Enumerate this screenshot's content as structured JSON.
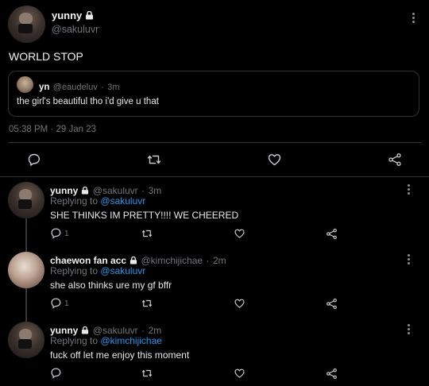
{
  "main_tweet": {
    "display_name": "yunny",
    "handle": "@sakuluvr",
    "text": "WORLD STOP",
    "timestamp": "05:38 PM",
    "date": "29 Jan 23",
    "separator": "·",
    "quote": {
      "display_name": "yn",
      "handle": "@eaudeluv",
      "time": "3m",
      "separator": "·",
      "text": "the girl's beautiful tho i'd give u that"
    }
  },
  "replies": [
    {
      "display_name": "yunny",
      "handle": "@sakuluvr",
      "time": "3m",
      "separator": "·",
      "replying_prefix": "Replying to",
      "replying_to": "@sakuluvr",
      "text": "SHE THINKS IM PRETTY!!!! WE CHEERED",
      "reply_count": "1"
    },
    {
      "display_name": "chaewon fan acc",
      "handle": "@kimchijichae",
      "time": "2m",
      "separator": "·",
      "replying_prefix": "Replying to",
      "replying_to": "@sakuluvr",
      "text": "she also thinks ure my gf bffr",
      "reply_count": "1"
    },
    {
      "display_name": "yunny",
      "handle": "@sakuluvr",
      "time": "2m",
      "separator": "·",
      "replying_prefix": "Replying to",
      "replying_to": "@kimchijichae",
      "text": "fuck off let me enjoy this moment",
      "reply_count": ""
    }
  ],
  "colors": {
    "background": "#000000",
    "link": "#1d9bf0",
    "secondary_text": "#71767b",
    "divider": "#2f3336"
  },
  "icons": [
    "lock-icon",
    "more-icon",
    "reply-icon",
    "retweet-icon",
    "like-icon",
    "share-icon"
  ]
}
